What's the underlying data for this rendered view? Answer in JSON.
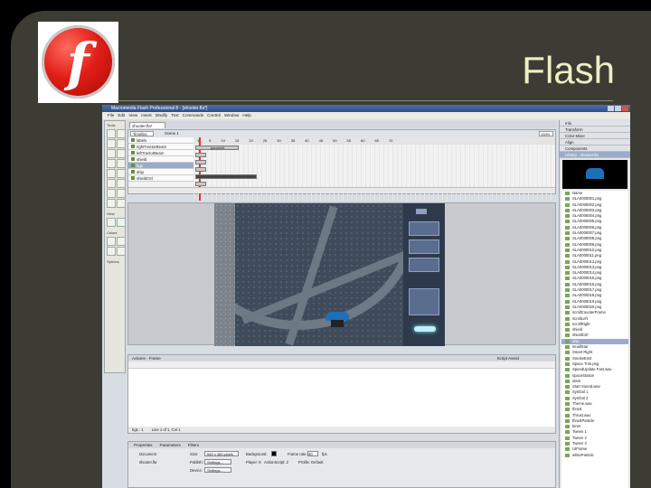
{
  "slide": {
    "title": "Flash",
    "logo_icon": "flash-player-logo-icon",
    "logo_letter": "f"
  },
  "app": {
    "window_title": "Macromedia Flash Professional 8 - [shooter.fla*]",
    "menu": [
      "File",
      "Edit",
      "View",
      "Insert",
      "Modify",
      "Text",
      "Commands",
      "Control",
      "Window",
      "Help"
    ],
    "document_tab": "shooter.fla*",
    "timeline_button": "Timeline",
    "scene_label": "Scene 1",
    "zoom_value": "100%",
    "tools_label": "Tools",
    "view_label": "View",
    "colors_label": "Colors",
    "options_label": "Options",
    "frame_numbers": [
      "1",
      "5",
      "10",
      "15",
      "20",
      "25",
      "30",
      "35",
      "40",
      "45",
      "50",
      "55",
      "60",
      "65",
      "70"
    ],
    "layers": [
      {
        "name": "labels"
      },
      {
        "name": "rightTractorBeam"
      },
      {
        "name": "leftTractorBeam"
      },
      {
        "name": "shield"
      },
      {
        "name": "bgs",
        "selected": true
      },
      {
        "name": "ship"
      },
      {
        "name": "shieldCtrl"
      }
    ],
    "layer_label_frame": "gameInit",
    "actions_title": "Actions - Frame",
    "script_assist": "Script Assist",
    "actions_footer": "bgs : 1",
    "actions_status": "Line 1 of 1, Col 1",
    "properties_tabs": [
      "Properties",
      "Parameters",
      "Filters"
    ],
    "properties": {
      "doc_label": "Document",
      "doc_name": "shooter.fla",
      "size_label": "Size:",
      "size_value": "640 x 480 pixels",
      "background_label": "Background:",
      "fps_label": "Frame rate:",
      "fps_value": "30",
      "fps_unit": "fps",
      "publish_label": "Publish:",
      "settings_button": "Settings...",
      "player_label": "Player: 8",
      "actionscript_label": "ActionScript: 2",
      "profile_label": "Profile: Default",
      "device_label": "Device:",
      "device_button": "Settings..."
    },
    "right_panels": [
      "Info",
      "Transform",
      "Color Mixer",
      "Align",
      "Components"
    ],
    "library_title": "Library - shooter.fla",
    "library_items": [
      "Name",
      "SLA0000001.png",
      "SLA0000002.png",
      "SLA0000003.png",
      "SLA0000004.png",
      "SLA0000005.png",
      "SLA0000006.png",
      "SLA0000007.png",
      "SLA0000008.png",
      "SLA0000009.png",
      "SLA0000010.png",
      "SLA0000011.png",
      "SLA0000012.png",
      "SLA0000013.png",
      "SLA0000014.png",
      "SLA0000015.png",
      "SLA0000016.png",
      "SLA0000017.png",
      "SLA0000018.png",
      "SLA0000019.png",
      "SLA0000020.png",
      "scrollCounterFrame",
      "scrollLeft",
      "scrollRight",
      "shield",
      "shieldCtrl",
      "ship",
      "smallStar",
      "Smart Right",
      "SmokeEmit",
      "Space Trim.png",
      "SpeedUpdate Fast.wav",
      "spaceStation",
      "stars",
      "Start Sound.wav",
      "Symbol 1",
      "Symbol 2",
      "Theme.wav",
      "thrust",
      "Thrust.wav",
      "thrustParticle",
      "timer",
      "Tween 1",
      "Tween 2",
      "Tween 3",
      "UIFrame",
      "whiteParticle"
    ],
    "library_selected_index": 26
  }
}
